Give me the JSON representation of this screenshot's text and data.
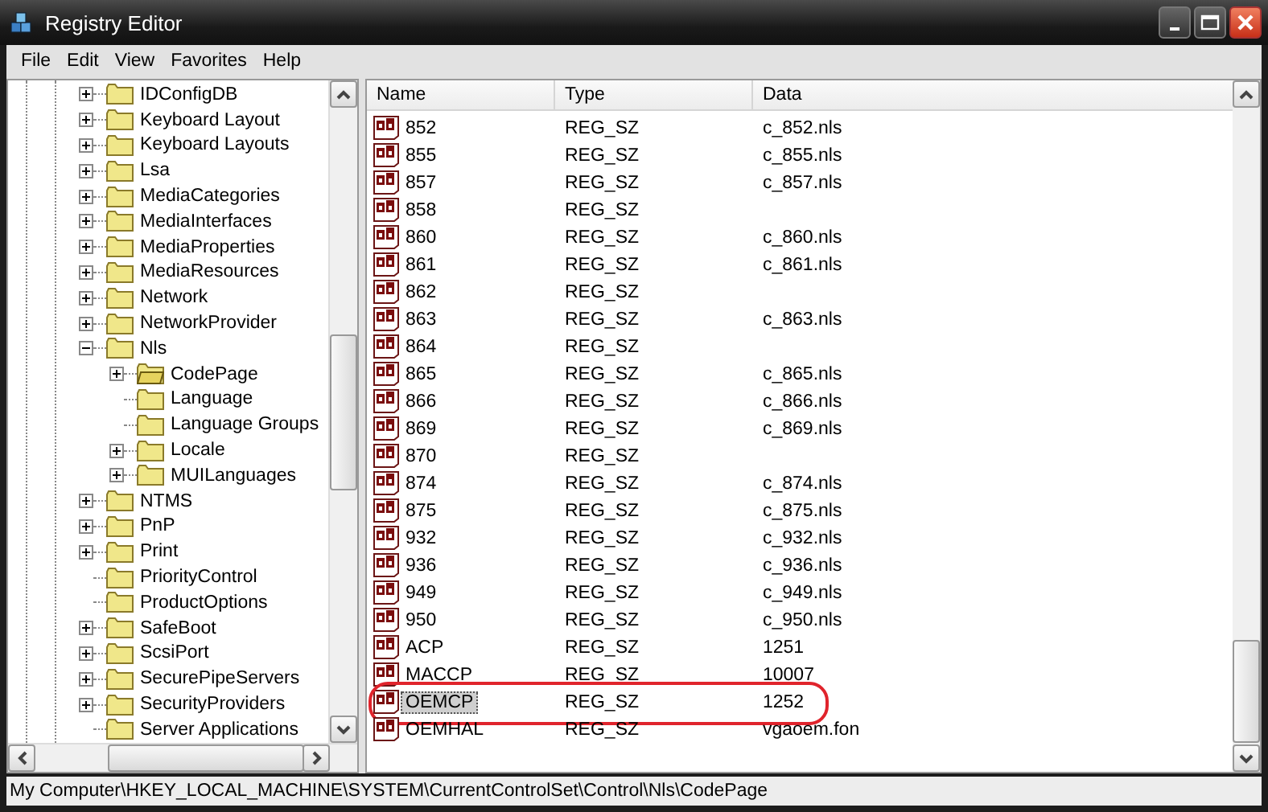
{
  "window": {
    "title": "Registry Editor"
  },
  "menu": [
    "File",
    "Edit",
    "View",
    "Favorites",
    "Help"
  ],
  "tree": {
    "items": [
      {
        "name": "IDConfigDB",
        "expanded": false,
        "selected": false
      },
      {
        "name": "Keyboard Layout",
        "expanded": false,
        "selected": false
      },
      {
        "name": "Keyboard Layouts",
        "expanded": false,
        "selected": false
      },
      {
        "name": "Lsa",
        "expanded": false,
        "selected": false
      },
      {
        "name": "MediaCategories",
        "expanded": false,
        "selected": false
      },
      {
        "name": "MediaInterfaces",
        "expanded": false,
        "selected": false
      },
      {
        "name": "MediaProperties",
        "expanded": false,
        "selected": false
      },
      {
        "name": "MediaResources",
        "expanded": false,
        "selected": false
      },
      {
        "name": "Network",
        "expanded": false,
        "selected": false
      },
      {
        "name": "NetworkProvider",
        "expanded": false,
        "selected": false
      },
      {
        "name": "Nls",
        "expanded": true,
        "selected": false,
        "children": [
          {
            "name": "CodePage",
            "expanded": false,
            "selected": true
          },
          {
            "name": "Language",
            "selected": false
          },
          {
            "name": "Language Groups",
            "selected": false
          },
          {
            "name": "Locale",
            "expanded": false,
            "selected": false
          },
          {
            "name": "MUILanguages",
            "expanded": false,
            "selected": false
          }
        ]
      },
      {
        "name": "NTMS",
        "expanded": false,
        "selected": false
      },
      {
        "name": "PnP",
        "expanded": false,
        "selected": false
      },
      {
        "name": "Print",
        "expanded": false,
        "selected": false
      },
      {
        "name": "PriorityControl",
        "selected": false
      },
      {
        "name": "ProductOptions",
        "selected": false
      },
      {
        "name": "SafeBoot",
        "expanded": false,
        "selected": false
      },
      {
        "name": "ScsiPort",
        "expanded": false,
        "selected": false
      },
      {
        "name": "SecurePipeServers",
        "expanded": false,
        "selected": false
      },
      {
        "name": "SecurityProviders",
        "expanded": false,
        "selected": false
      },
      {
        "name": "Server Applications",
        "selected": false
      }
    ]
  },
  "table": {
    "columns": [
      "Name",
      "Type",
      "Data"
    ],
    "rows": [
      {
        "name": "852",
        "type": "REG_SZ",
        "data": "c_852.nls",
        "selected": false,
        "circled": false
      },
      {
        "name": "855",
        "type": "REG_SZ",
        "data": "c_855.nls",
        "selected": false,
        "circled": false
      },
      {
        "name": "857",
        "type": "REG_SZ",
        "data": "c_857.nls",
        "selected": false,
        "circled": false
      },
      {
        "name": "858",
        "type": "REG_SZ",
        "selected": false,
        "circled": false
      },
      {
        "name": "860",
        "type": "REG_SZ",
        "data": "c_860.nls",
        "selected": false,
        "circled": false
      },
      {
        "name": "861",
        "type": "REG_SZ",
        "data": "c_861.nls",
        "selected": false,
        "circled": false
      },
      {
        "name": "862",
        "type": "REG_SZ",
        "selected": false,
        "circled": false
      },
      {
        "name": "863",
        "type": "REG_SZ",
        "data": "c_863.nls",
        "selected": false,
        "circled": false
      },
      {
        "name": "864",
        "type": "REG_SZ",
        "selected": false,
        "circled": false
      },
      {
        "name": "865",
        "type": "REG_SZ",
        "data": "c_865.nls",
        "selected": false,
        "circled": false
      },
      {
        "name": "866",
        "type": "REG_SZ",
        "data": "c_866.nls",
        "selected": false,
        "circled": false
      },
      {
        "name": "869",
        "type": "REG_SZ",
        "data": "c_869.nls",
        "selected": false,
        "circled": false
      },
      {
        "name": "870",
        "type": "REG_SZ",
        "selected": false,
        "circled": false
      },
      {
        "name": "874",
        "type": "REG_SZ",
        "data": "c_874.nls",
        "selected": false,
        "circled": false
      },
      {
        "name": "875",
        "type": "REG_SZ",
        "data": "c_875.nls",
        "selected": false,
        "circled": false
      },
      {
        "name": "932",
        "type": "REG_SZ",
        "data": "c_932.nls",
        "selected": false,
        "circled": false
      },
      {
        "name": "936",
        "type": "REG_SZ",
        "data": "c_936.nls",
        "selected": false,
        "circled": false
      },
      {
        "name": "949",
        "type": "REG_SZ",
        "data": "c_949.nls",
        "selected": false,
        "circled": false
      },
      {
        "name": "950",
        "type": "REG_SZ",
        "data": "c_950.nls",
        "selected": false,
        "circled": false
      },
      {
        "name": "ACP",
        "type": "REG_SZ",
        "data": "1251",
        "selected": false,
        "circled": false
      },
      {
        "name": "MACCP",
        "type": "REG_SZ",
        "data": "10007",
        "selected": false,
        "circled": false
      },
      {
        "name": "OEMCP",
        "type": "REG_SZ",
        "data": "1252",
        "selected": true,
        "circled": true
      },
      {
        "name": "OEMHAL",
        "type": "REG_SZ",
        "data": "vgaoem.fon",
        "selected": false,
        "circled": false
      }
    ]
  },
  "status_bar": "My Computer\\HKEY_LOCAL_MACHINE\\SYSTEM\\CurrentControlSet\\Control\\Nls\\CodePage"
}
